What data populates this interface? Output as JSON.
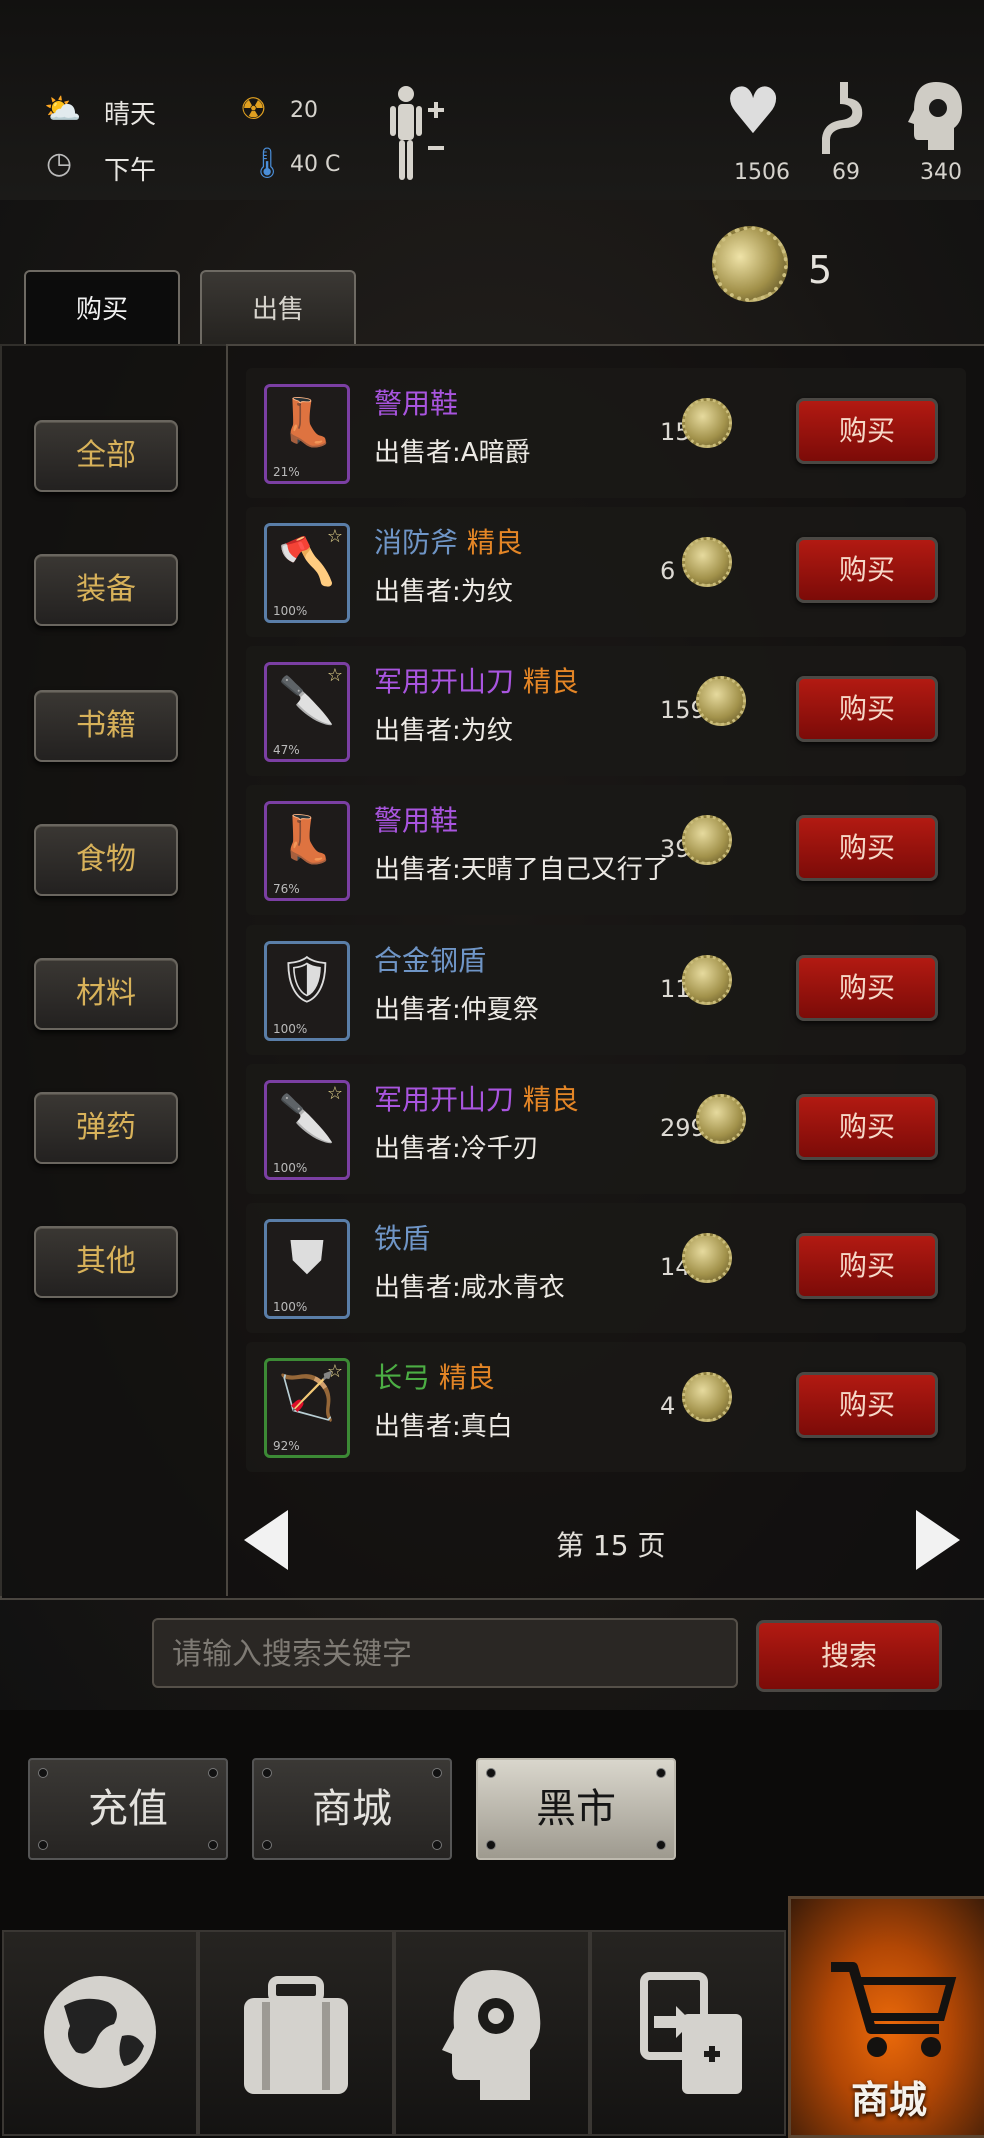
{
  "status": {
    "weather": "晴天",
    "time": "下午",
    "radiation": "20",
    "temperature": "40 C",
    "health": "1506",
    "hunger": "69",
    "mind": "340"
  },
  "currency": {
    "amount": "5"
  },
  "tabs": {
    "buy": "购买",
    "sell": "出售"
  },
  "categories": [
    "全部",
    "装备",
    "书籍",
    "食物",
    "材料",
    "弹药",
    "其他"
  ],
  "items": [
    {
      "name": "警用鞋",
      "quality": "",
      "seller": "出售者:A暗爵",
      "price": "15",
      "percent": "21%",
      "name_color": "#a955df",
      "icon": "boots-icon"
    },
    {
      "name": "消防斧",
      "quality": "精良",
      "seller": "出售者:为纹",
      "price": "6",
      "percent": "100%",
      "name_color": "#6f95c6",
      "icon": "axe-icon"
    },
    {
      "name": "军用开山刀",
      "quality": "精良",
      "seller": "出售者:为纹",
      "price": "159",
      "percent": "47%",
      "name_color": "#a955df",
      "icon": "machete-icon"
    },
    {
      "name": "警用鞋",
      "quality": "",
      "seller": "出售者:天晴了自己又行了",
      "price": "39",
      "percent": "76%",
      "name_color": "#a955df",
      "icon": "boots-icon"
    },
    {
      "name": "合金钢盾",
      "quality": "",
      "seller": "出售者:仲夏祭",
      "price": "11",
      "percent": "100%",
      "name_color": "#6f95c6",
      "icon": "shield-icon"
    },
    {
      "name": "军用开山刀",
      "quality": "精良",
      "seller": "出售者:冷千刃",
      "price": "299",
      "percent": "100%",
      "name_color": "#a955df",
      "icon": "machete-icon"
    },
    {
      "name": "铁盾",
      "quality": "",
      "seller": "出售者:咸水青衣",
      "price": "14",
      "percent": "100%",
      "name_color": "#6f95c6",
      "icon": "round-shield-icon"
    },
    {
      "name": "长弓",
      "quality": "精良",
      "seller": "出售者:真白",
      "price": "4",
      "percent": "92%",
      "name_color": "#4cae44",
      "icon": "bow-icon"
    }
  ],
  "buy_label": "购买",
  "pagination": {
    "text": "第 15 页"
  },
  "search": {
    "placeholder": "请输入搜索关键字",
    "button": "搜索"
  },
  "store_tabs": [
    "充值",
    "商城",
    "黑市"
  ],
  "bottom_nav": {
    "shop_label": "商城"
  }
}
